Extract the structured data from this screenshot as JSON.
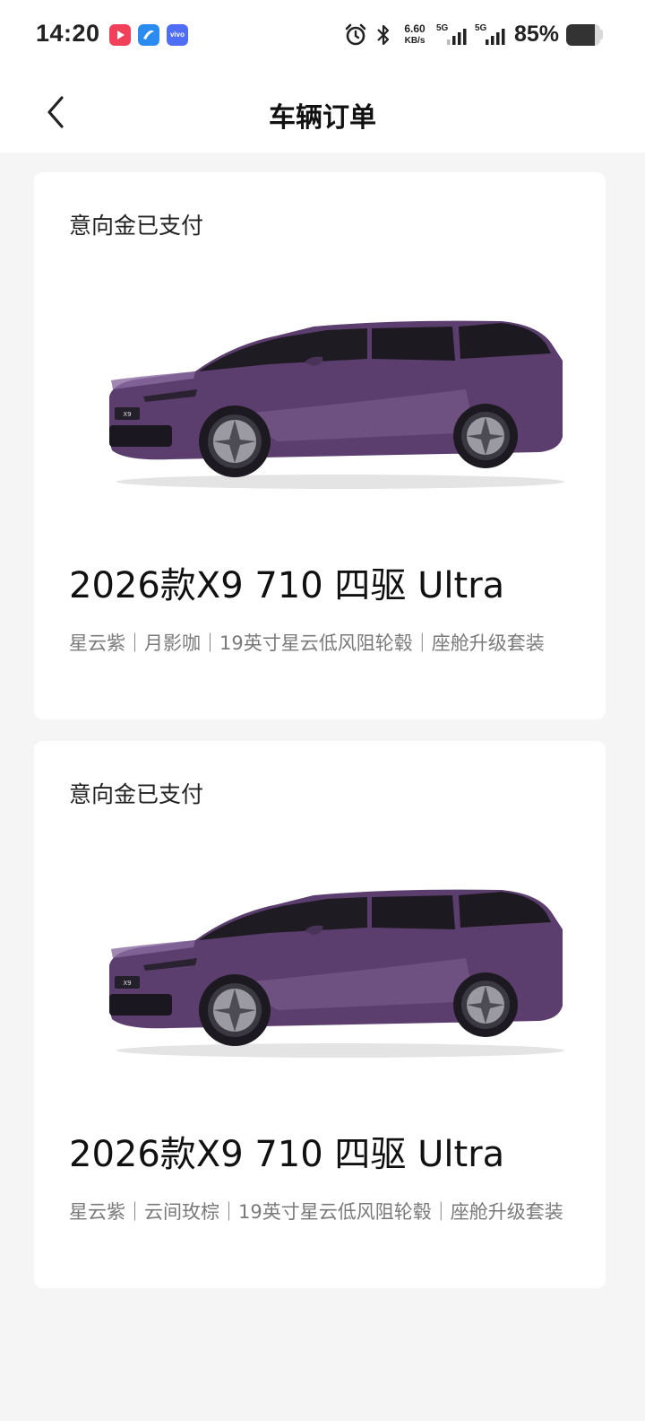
{
  "status_bar": {
    "time": "14:20",
    "net_speed_value": "6.60",
    "net_speed_unit": "KB/s",
    "signal1_label": "5G",
    "signal2_label": "5G",
    "battery_text": "85%",
    "battery_level": 0.85,
    "app_icons": [
      "video-app-icon",
      "browser-app-icon",
      "vivo-app-icon"
    ],
    "vivo_icon_text": "vivo"
  },
  "nav": {
    "title": "车辆订单"
  },
  "orders": [
    {
      "status": "意向金已支付",
      "title": "2026款X9 710 四驱 Ultra",
      "specs": "星云紫｜月影咖｜19英寸星云低风阻轮毂｜座舱升级套装",
      "car_badge": "X9",
      "car_color": "#5b3e6e"
    },
    {
      "status": "意向金已支付",
      "title": "2026款X9 710 四驱 Ultra",
      "specs": "星云紫｜云间玫棕｜19英寸星云低风阻轮毂｜座舱升级套装",
      "car_badge": "X9",
      "car_color": "#5b3e6e"
    }
  ]
}
